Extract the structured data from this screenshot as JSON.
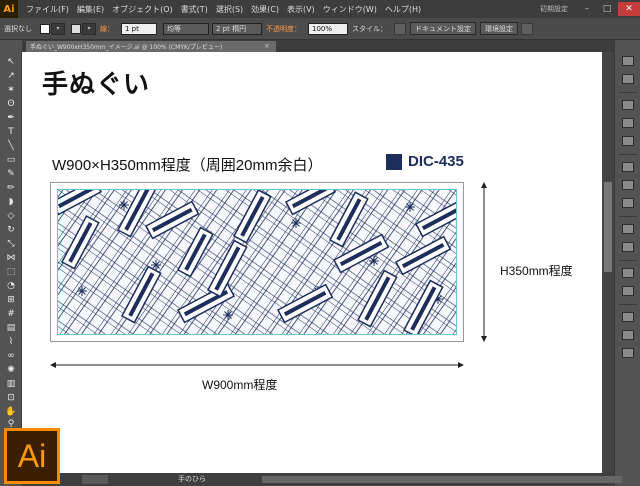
{
  "app": {
    "logo_text": "Ai",
    "badge_text": "Ai"
  },
  "menu": {
    "items": [
      "ファイル(F)",
      "編集(E)",
      "オブジェクト(O)",
      "書式(T)",
      "選択(S)",
      "効果(C)",
      "表示(V)",
      "ウィンドウ(W)",
      "ヘルプ(H)"
    ],
    "workspace": "初期設定"
  },
  "control_bar": {
    "selection": "選択なし",
    "stroke_label": "線：",
    "stroke_weight": "1 pt",
    "brush_label": "均等",
    "brush_value": "2 pt 楕円",
    "opacity_label": "不透明度：",
    "opacity_value": "100%",
    "style_label": "スタイル：",
    "doc_setup": "ドキュメント設定",
    "prefs": "環境設定"
  },
  "tab": {
    "title": "手ぬぐい_W900xH350mm_イメージ.ai @ 100% (CMYK/プレビュー)"
  },
  "artboard": {
    "title": "手ぬぐい",
    "size_text": "W900×H350mm程度（周囲20mm余白）",
    "dic_code": "DIC-435",
    "height_label": "H350mm程度",
    "width_label": "W900mm程度"
  },
  "status_bar": {
    "tool": "手のひら"
  },
  "colors": {
    "ink": "#1d2e5c",
    "guide": "#67c6d6",
    "accent": "#ff8c00"
  }
}
